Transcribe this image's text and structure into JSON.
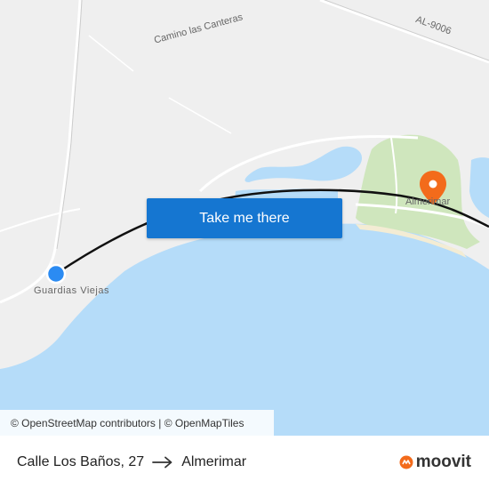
{
  "map": {
    "labels": {
      "road_canteras": "Camino las Canteras",
      "road_al9006": "AL-9006",
      "town_guardias": "Guardias Viejas",
      "town_almerimar": "Almerimar"
    },
    "colors": {
      "land": "#efefef",
      "water": "#b5dcf9",
      "park": "#cfe6bd",
      "route": "#111111",
      "origin": "#2b8bf2",
      "destination": "#f36b1b"
    }
  },
  "cta": {
    "label": "Take me there"
  },
  "attribution": {
    "text": "© OpenStreetMap contributors | © OpenMapTiles"
  },
  "route": {
    "origin": "Calle Los Baños, 27",
    "destination": "Almerimar",
    "arrow_icon": "arrow-right-icon"
  },
  "brand": {
    "name": "moovit",
    "icon": "moovit-logo-icon"
  }
}
